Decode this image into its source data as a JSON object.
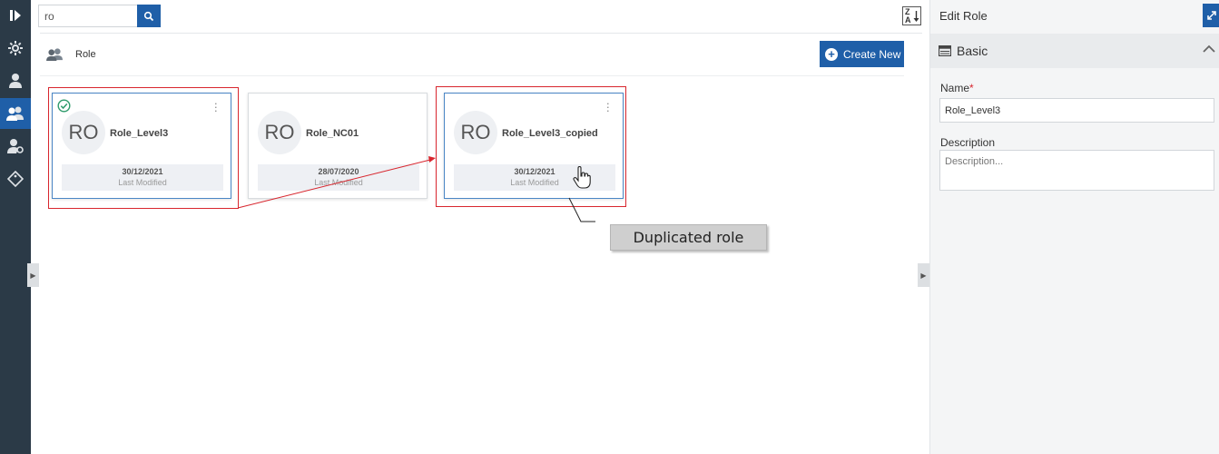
{
  "rail": {
    "items": [
      {
        "icon": "play-forward-icon"
      },
      {
        "icon": "settings-icon"
      },
      {
        "icon": "user-icon"
      },
      {
        "icon": "users-icon",
        "active": true
      },
      {
        "icon": "user-settings-icon"
      },
      {
        "icon": "tag-icon"
      }
    ]
  },
  "search": {
    "value": "ro",
    "placeholder": ""
  },
  "section": {
    "title": "Role"
  },
  "toolbar": {
    "create_label": "Create New",
    "sort_top": "Z",
    "sort_bottom": "A"
  },
  "cards": [
    {
      "initials": "RO",
      "name": "Role_Level3",
      "date": "30/12/2021",
      "modified_label": "Last Modified",
      "checked": true
    },
    {
      "initials": "RO",
      "name": "Role_NC01",
      "date": "28/07/2020",
      "modified_label": "Last Modified",
      "checked": false
    },
    {
      "initials": "RO",
      "name": "Role_Level3_copied",
      "date": "30/12/2021",
      "modified_label": "Last Modified",
      "checked": false
    }
  ],
  "annotation": {
    "callout": "Duplicated role"
  },
  "panel": {
    "title": "Edit Role",
    "section_label": "Basic",
    "name_label": "Name",
    "name_required": "*",
    "name_value": "Role_Level3",
    "description_label": "Description",
    "description_placeholder": "Description..."
  },
  "colors": {
    "accent": "#1f5fa8",
    "rail": "#2b3a47",
    "annotation": "#d8262e"
  }
}
